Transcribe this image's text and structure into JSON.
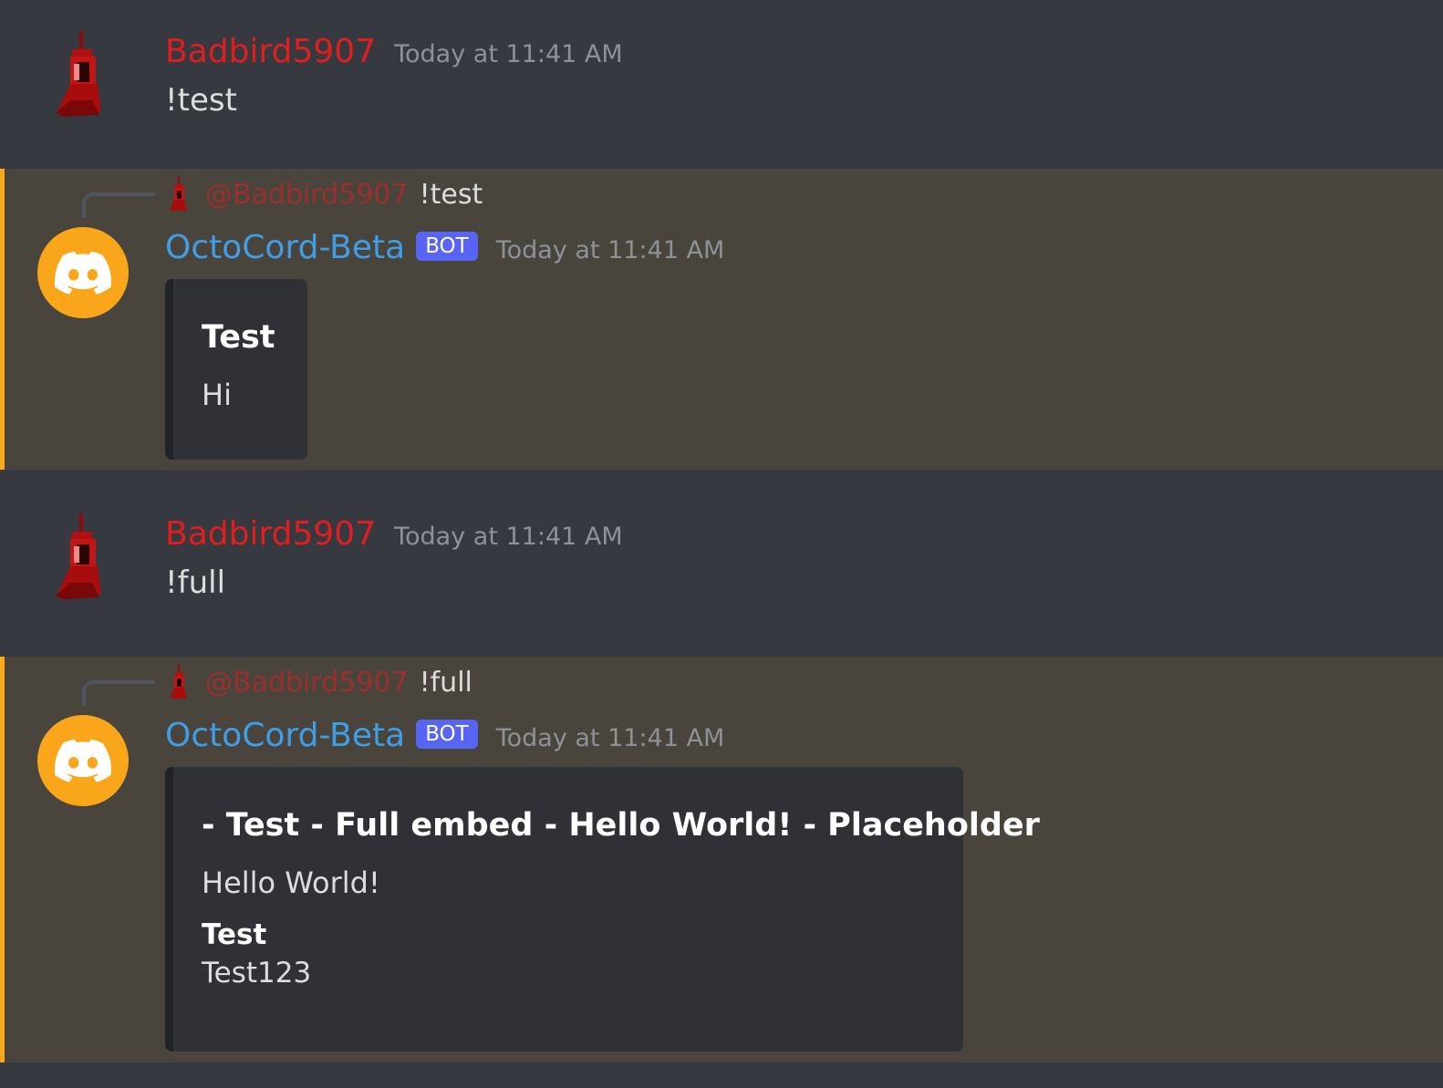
{
  "messages": [
    {
      "author": "Badbird5907",
      "timestamp": "Today at 11:41 AM",
      "content": "!test",
      "avatar_icon": "red-pixel-character-icon"
    },
    {
      "author": "OctoCord-Beta",
      "tag": "BOT",
      "timestamp": "Today at 11:41 AM",
      "avatar_icon": "discord-logo-icon",
      "reply_to": {
        "author": "@Badbird5907",
        "content": "!test"
      },
      "embed": {
        "title": "Test",
        "description": "Hi"
      }
    },
    {
      "author": "Badbird5907",
      "timestamp": "Today at 11:41 AM",
      "content": "!full",
      "avatar_icon": "red-pixel-character-icon"
    },
    {
      "author": "OctoCord-Beta",
      "tag": "BOT",
      "timestamp": "Today at 11:41 AM",
      "avatar_icon": "discord-logo-icon",
      "reply_to": {
        "author": "@Badbird5907",
        "content": "!full"
      },
      "embed": {
        "title": "- Test - Full embed - Hello World! - Placeholder",
        "description": "Hello World!",
        "fields": [
          {
            "name": "Test",
            "value": "Test123"
          }
        ]
      }
    }
  ],
  "colors": {
    "background": "#36393f",
    "mention_highlight": "#49443c",
    "mention_bar": "#faa81a",
    "user_name": "#e01e1e",
    "bot_name": "#3f9ee6",
    "bot_tag": "#5865f2",
    "embed_bg": "#2f3136",
    "bot_avatar_bg": "#faa61a"
  }
}
